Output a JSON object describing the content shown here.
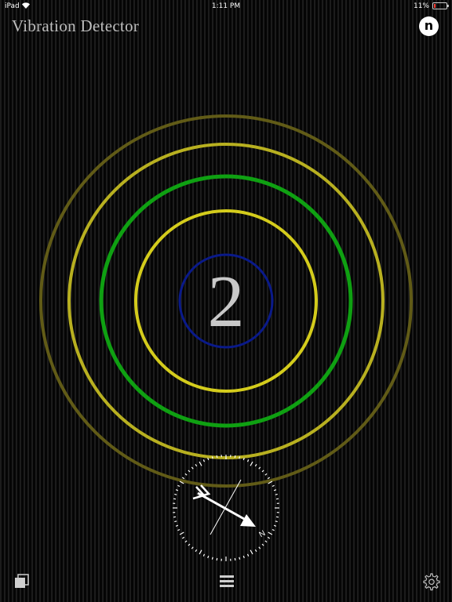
{
  "status_bar": {
    "device": "iPad",
    "time": "1:11 PM",
    "battery": "11%"
  },
  "app": {
    "title": "Vibration Detector",
    "badge_letter": "n"
  },
  "detector": {
    "level": "2",
    "rings": [
      {
        "ring": "center",
        "color": "#0a1a8a"
      },
      {
        "ring": "inner",
        "color": "#d4cc1c"
      },
      {
        "ring": "middle",
        "color": "#0fa012"
      },
      {
        "ring": "outer",
        "color": "#b8b020"
      },
      {
        "ring": "outermost",
        "color": "#6a6418"
      }
    ]
  },
  "compass": {
    "heading_label": "N"
  },
  "toolbar": {
    "windows_icon": "windows-icon",
    "menu_icon": "menu-icon",
    "settings_icon": "gear-icon"
  }
}
